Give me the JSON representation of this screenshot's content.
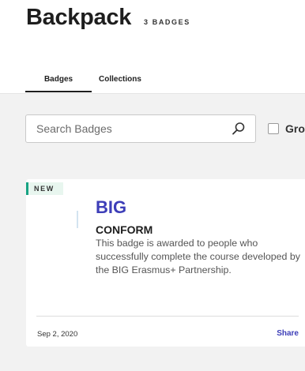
{
  "header": {
    "title": "Backpack",
    "badge_count": "3 BADGES"
  },
  "tabs": [
    {
      "label": "Badges",
      "active": true
    },
    {
      "label": "Collections",
      "active": false
    }
  ],
  "search": {
    "placeholder": "Search Badges",
    "value": "",
    "icon": "search-icon"
  },
  "group_toggle": {
    "label": "Gro",
    "checked": false
  },
  "badges": [
    {
      "status": "NEW",
      "name": "BIG",
      "issuer": "CONFORM",
      "description": "This badge is awarded to people who successfully complete the course developed by the BIG Erasmus+ Partnership.",
      "date": "Sep 2, 2020",
      "action": "Share"
    }
  ],
  "colors": {
    "accent": "#3d3eb8",
    "new_marker": "#17a383",
    "background": "#f2f2f2"
  }
}
